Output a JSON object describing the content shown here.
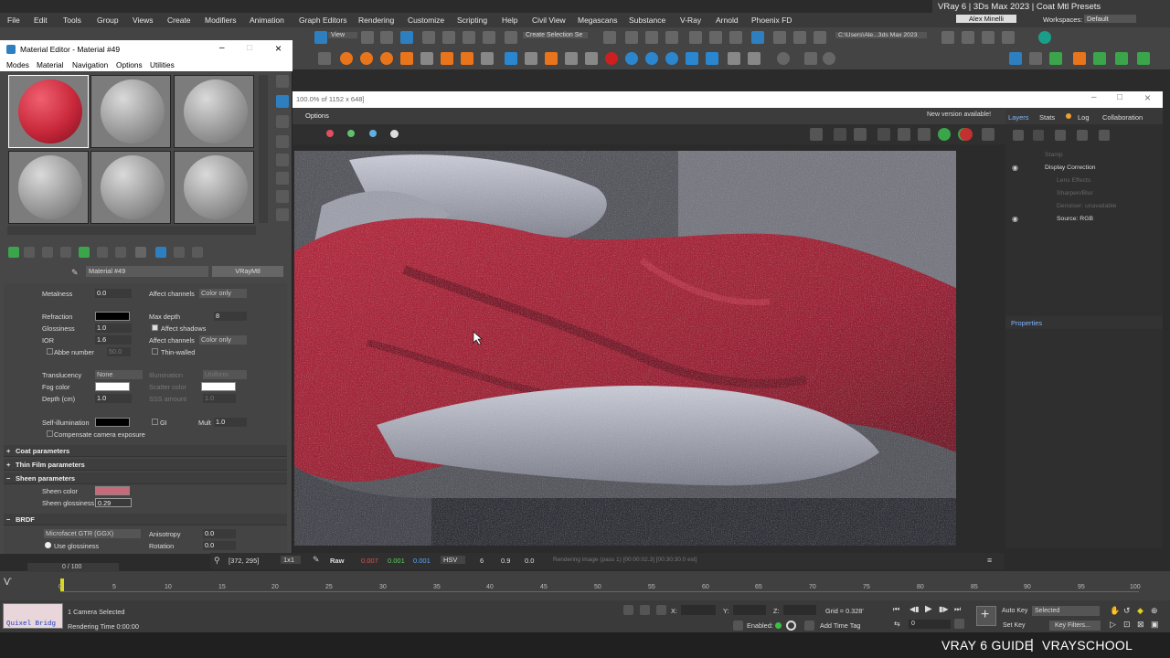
{
  "top_title": "VRay 6  |  3Ds Max 2023  |  Coat Mtl Presets",
  "menu": [
    "File",
    "Edit",
    "Tools",
    "Group",
    "Views",
    "Create",
    "Modifiers",
    "Animation",
    "Graph Editors",
    "Rendering",
    "Customize",
    "Scripting",
    "Help",
    "Civil View",
    "Megascans",
    "Substance",
    "V-Ray",
    "Arnold",
    "Phoenix FD"
  ],
  "user": "Alex Minelli",
  "workspace_label": "Workspaces:",
  "workspace_value": "Default",
  "selection_set": "Create Selection Se",
  "view_dropdown": "View",
  "all_dropdown": "All",
  "path": "C:\\Users\\Ale...3ds Max 2023",
  "mat_editor": {
    "title": "Material Editor - Material #49",
    "menus": [
      "Modes",
      "Material",
      "Navigation",
      "Options",
      "Utilities"
    ],
    "material_name": "Material #49",
    "material_type": "VRayMtl"
  },
  "params": {
    "metalness_label": "Metalness",
    "metalness": "0.0",
    "affect_channels_label": "Affect channels",
    "affect_channels": "Color only",
    "refraction_label": "Refraction",
    "max_depth_label": "Max depth",
    "max_depth": "8",
    "glossiness_label": "Glossiness",
    "glossiness": "1.0",
    "affect_shadows": "Affect shadows",
    "ior_label": "IOR",
    "ior": "1.6",
    "affect_channels2": "Color only",
    "abbe_label": "Abbe number",
    "abbe": "50.0",
    "thin_walled": "Thin-walled",
    "translucency_label": "Translucency",
    "translucency": "None",
    "illumination_label": "Illumination",
    "illumination": "Uniform",
    "fog_color_label": "Fog color",
    "scatter_color_label": "Scatter color",
    "depth_label": "Depth (cm)",
    "depth": "1.0",
    "sss_label": "SSS amount",
    "sss": "1.0",
    "self_illum_label": "Self-illumination",
    "gi_label": "GI",
    "mult_label": "Mult",
    "mult": "1.0",
    "comp_camera": "Compensate camera exposure"
  },
  "sections": {
    "coat": "Coat parameters",
    "thin_film": "Thin Film parameters",
    "sheen": "Sheen parameters",
    "brdf": "BRDF"
  },
  "sheen": {
    "color_label": "Sheen color",
    "gloss_label": "Sheen glossiness",
    "gloss": "0.29"
  },
  "brdf": {
    "type": "Microfacet GTR (GGX)",
    "aniso_label": "Anisotropy",
    "aniso": "0.0",
    "use_gloss": "Use glossiness",
    "rotation_label": "Rotation",
    "rotation": "0.0"
  },
  "vfb": {
    "title": "100.0% of 1152 x 648]",
    "options": "Options",
    "new_version": "New version available!",
    "coords": "[372, 295]",
    "zoom": "1x1",
    "raw": "Raw",
    "v1": "0.007",
    "v2": "0.001",
    "v3": "0.001",
    "mode": "HSV",
    "n1": "6",
    "n2": "0.9",
    "n3": "0.0",
    "status": "Rendering image (pass 1) [00:00:02.3] [00:30:30.0 est]"
  },
  "layers": {
    "tabs": [
      "Layers",
      "Stats",
      "Log",
      "Collaboration"
    ],
    "items": [
      "Stamp",
      "Display Correction",
      "Lens Effects",
      "Sharpen/Blur",
      "Denoiser: unavailable",
      "Source: RGB"
    ],
    "properties": "Properties"
  },
  "timeline": {
    "frame": "0 / 100",
    "ticks": [
      "0",
      "5",
      "10",
      "15",
      "20",
      "25",
      "30",
      "35",
      "40",
      "45",
      "50",
      "55",
      "60",
      "65",
      "70",
      "75",
      "80",
      "85",
      "90",
      "95",
      "100"
    ]
  },
  "bottom": {
    "quixel": "Quixel Bridg",
    "selected": "1 Camera Selected",
    "render_time": "Rendering Time  0:00:00",
    "x": "X:",
    "y": "Y:",
    "z": "Z:",
    "grid": "Grid = 0.328'",
    "enabled": "Enabled:",
    "add_time_tag": "Add Time Tag",
    "auto_key": "Auto Key",
    "set_key": "Set Key",
    "selected_dd": "Selected",
    "key_filters": "Key Filters...",
    "frame_field": "0"
  },
  "guide": {
    "left": "VRAY 6 GUIDE",
    "right": "VRAYSCHOOL"
  }
}
